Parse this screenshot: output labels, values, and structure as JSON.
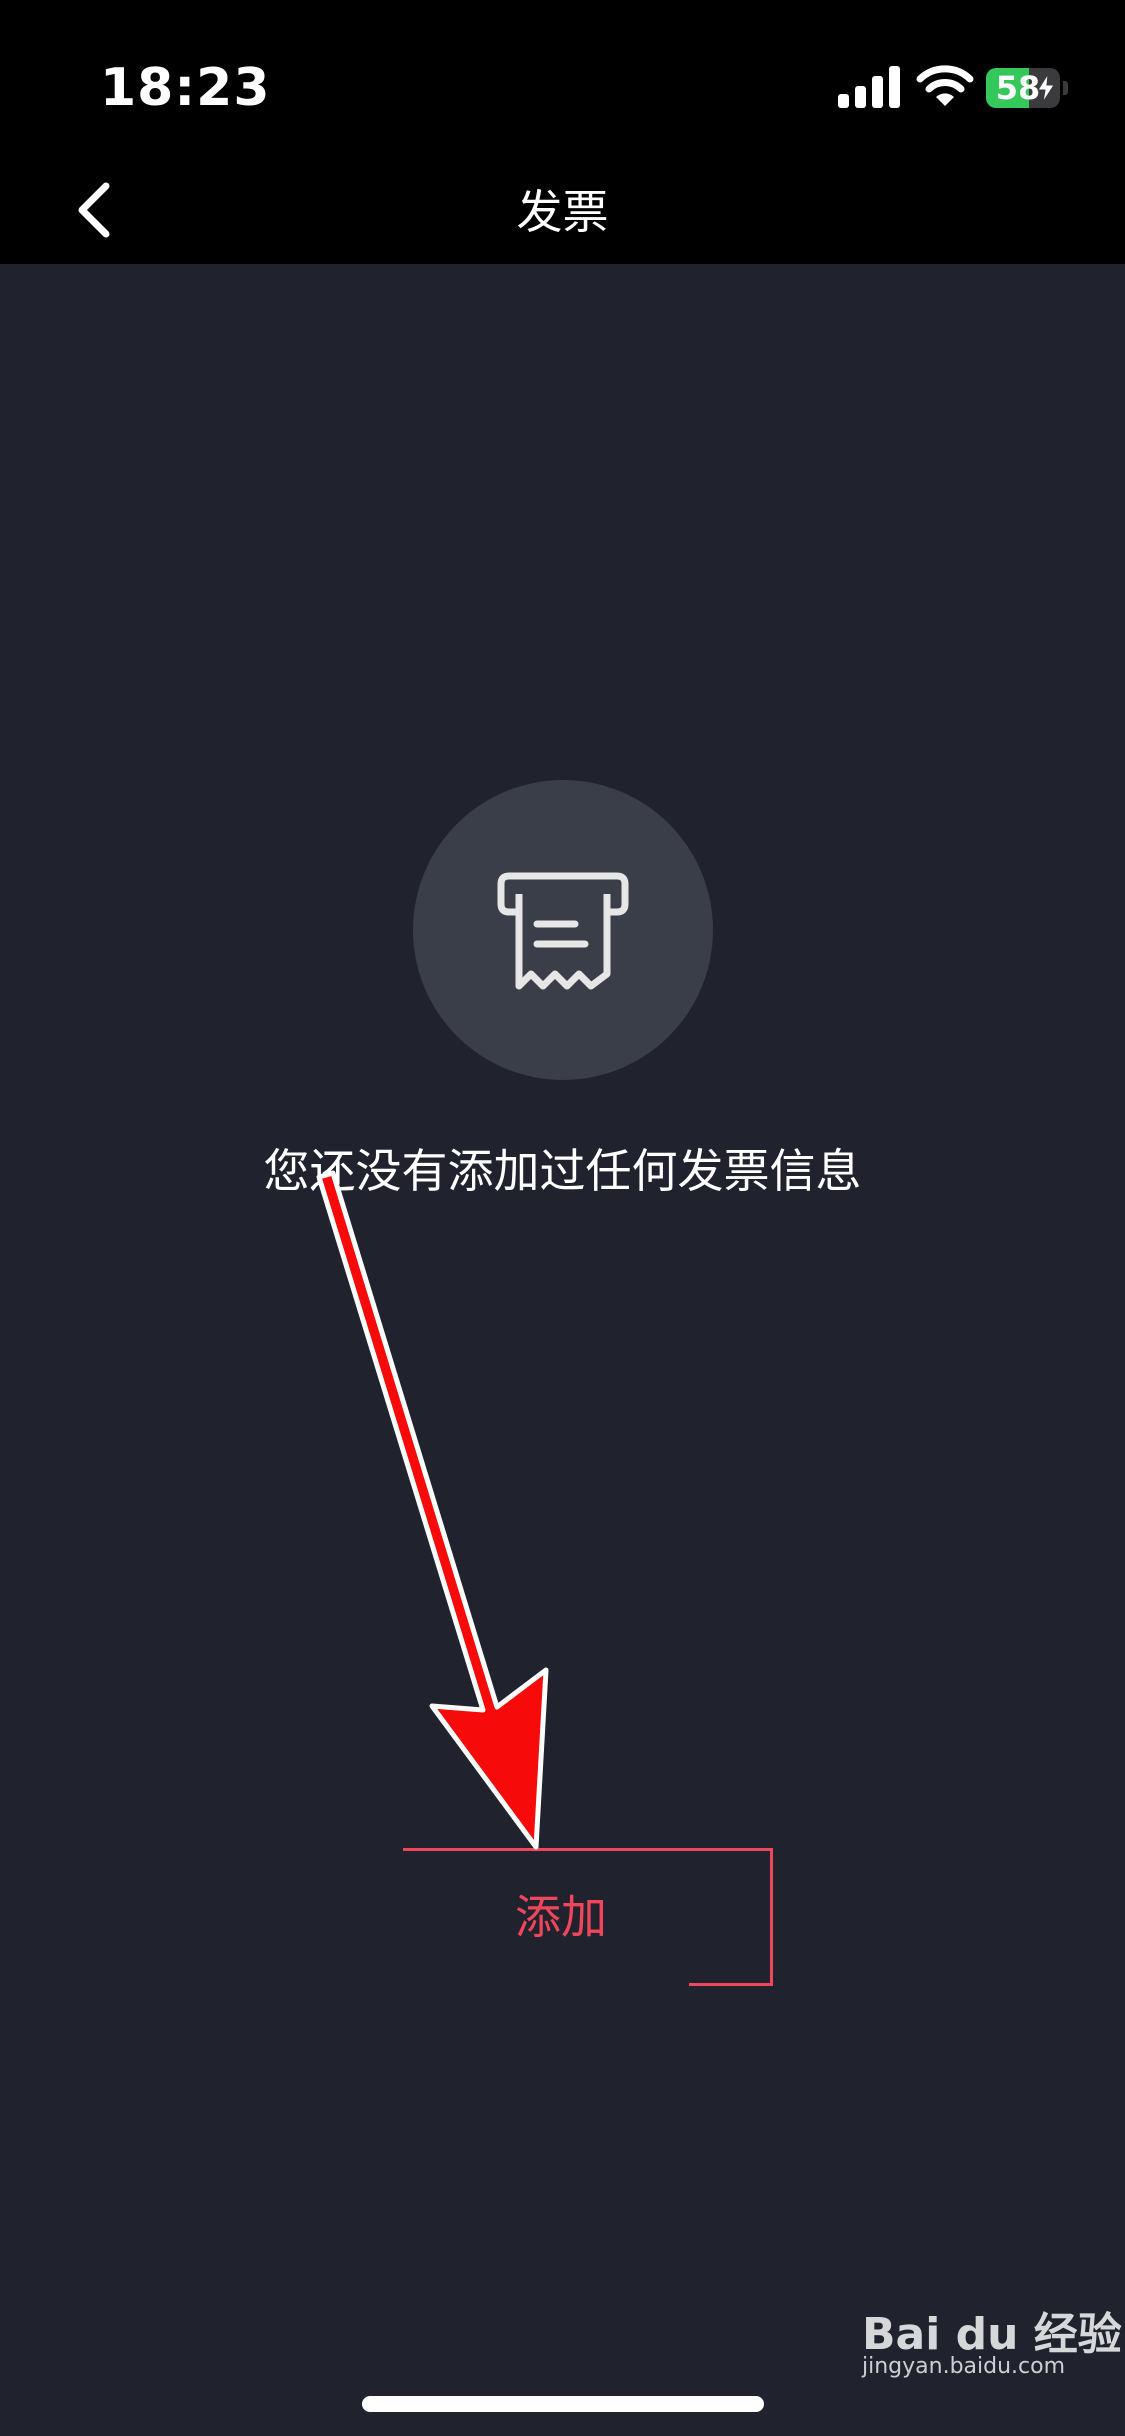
{
  "status_bar": {
    "time": "18:23",
    "battery_percent": 58,
    "battery_label": "58",
    "charging": true,
    "icons": [
      "signal-icon",
      "wifi-icon",
      "battery-icon",
      "bolt-icon"
    ]
  },
  "nav": {
    "title": "发票",
    "back_icon": "chevron-left-icon"
  },
  "empty_state": {
    "icon": "receipt-icon",
    "message": "您还没有添加过任何发票信息"
  },
  "actions": {
    "add_label": "添加"
  },
  "watermark": {
    "brand": "Bai du 经验",
    "url": "jingyan.baidu.com"
  },
  "colors": {
    "background": "#20232e",
    "bar": "#000000",
    "accent": "#f0465c",
    "circle": "#3a3e49",
    "battery_green": "#34c759",
    "annotation_red": "#f70a0a"
  }
}
